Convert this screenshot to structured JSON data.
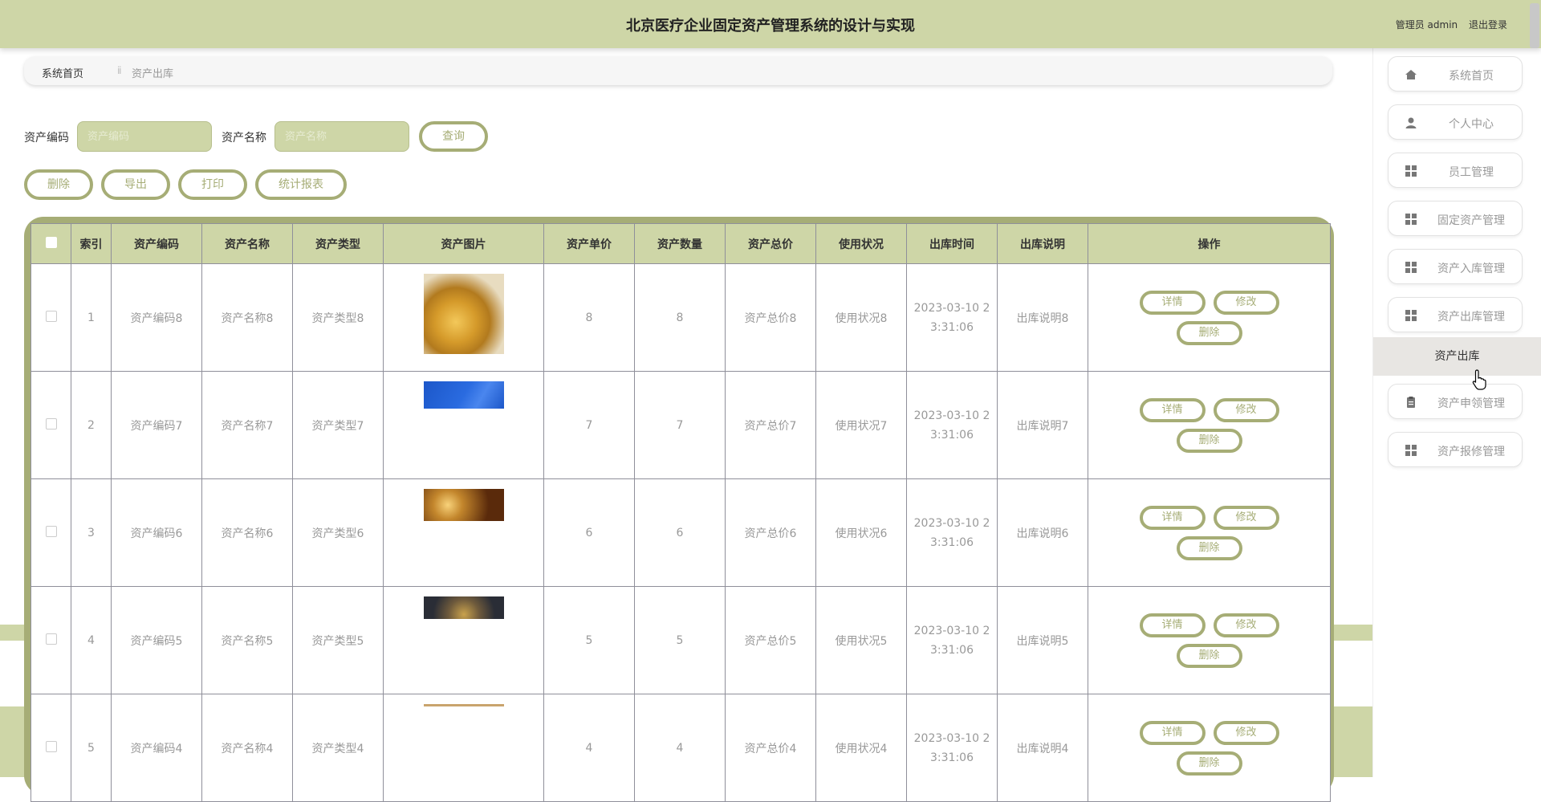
{
  "header": {
    "title": "北京医疗企业固定资产管理系统的设计与实现",
    "user_label": "管理员 admin",
    "logout_label": "退出登录"
  },
  "breadcrumb": {
    "home": "系统首页",
    "separator": "ⅱ",
    "current": "资产出库"
  },
  "search": {
    "code_label": "资产编码",
    "code_placeholder": "资产编码",
    "name_label": "资产名称",
    "name_placeholder": "资产名称",
    "query_button": "查询"
  },
  "actions": {
    "delete": "删除",
    "export": "导出",
    "print": "打印",
    "report": "统计报表"
  },
  "table": {
    "headers": [
      "索引",
      "资产编码",
      "资产名称",
      "资产类型",
      "资产图片",
      "资产单价",
      "资产数量",
      "资产总价",
      "使用状况",
      "出库时间",
      "出库说明",
      "操作"
    ],
    "rows": [
      {
        "index": "1",
        "code": "资产编码8",
        "name": "资产名称8",
        "type": "资产类型8",
        "image": "gold-coins",
        "price": "8",
        "qty": "8",
        "total": "资产总价8",
        "status": "使用状况8",
        "time_line1": "2023-03-10 2",
        "time_line2": "3:31:06",
        "note": "出库说明8"
      },
      {
        "index": "2",
        "code": "资产编码7",
        "name": "资产名称7",
        "type": "资产类型7",
        "image": "blue-building",
        "price": "7",
        "qty": "7",
        "total": "资产总价7",
        "status": "使用状况7",
        "time_line1": "2023-03-10 2",
        "time_line2": "3:31:06",
        "note": "出库说明7"
      },
      {
        "index": "3",
        "code": "资产编码6",
        "name": "资产名称6",
        "type": "资产类型6",
        "image": "coins-light",
        "price": "6",
        "qty": "6",
        "total": "资产总价6",
        "status": "使用状况6",
        "time_line1": "2023-03-10 2",
        "time_line2": "3:31:06",
        "note": "出库说明6"
      },
      {
        "index": "4",
        "code": "资产编码5",
        "name": "资产名称5",
        "type": "资产类型5",
        "image": "coins-dark",
        "price": "5",
        "qty": "5",
        "total": "资产总价5",
        "status": "使用状况5",
        "time_line1": "2023-03-10 2",
        "time_line2": "3:31:06",
        "note": "出库说明5"
      },
      {
        "index": "5",
        "code": "资产编码4",
        "name": "资产名称4",
        "type": "资产类型4",
        "image": "thin-strip",
        "price": "4",
        "qty": "4",
        "total": "资产总价4",
        "status": "使用状况4",
        "time_line1": "2023-03-10 2",
        "time_line2": "3:31:06",
        "note": "出库说明4"
      }
    ],
    "row_buttons": {
      "detail": "详情",
      "edit": "修改",
      "delete": "删除"
    }
  },
  "sidebar": {
    "items": [
      {
        "label": "系统首页",
        "icon": "home-icon"
      },
      {
        "label": "个人中心",
        "icon": "user-icon"
      },
      {
        "label": "员工管理",
        "icon": "grid-icon"
      },
      {
        "label": "固定资产管理",
        "icon": "grid-icon"
      },
      {
        "label": "资产入库管理",
        "icon": "grid-icon"
      },
      {
        "label": "资产出库管理",
        "icon": "grid-icon"
      },
      {
        "label": "资产申领管理",
        "icon": "clipboard-icon"
      },
      {
        "label": "资产报修管理",
        "icon": "grid-icon"
      }
    ],
    "active_sub": "资产出库"
  },
  "colors": {
    "accent": "#ced6a7",
    "accent_dark": "#a6ad76"
  }
}
